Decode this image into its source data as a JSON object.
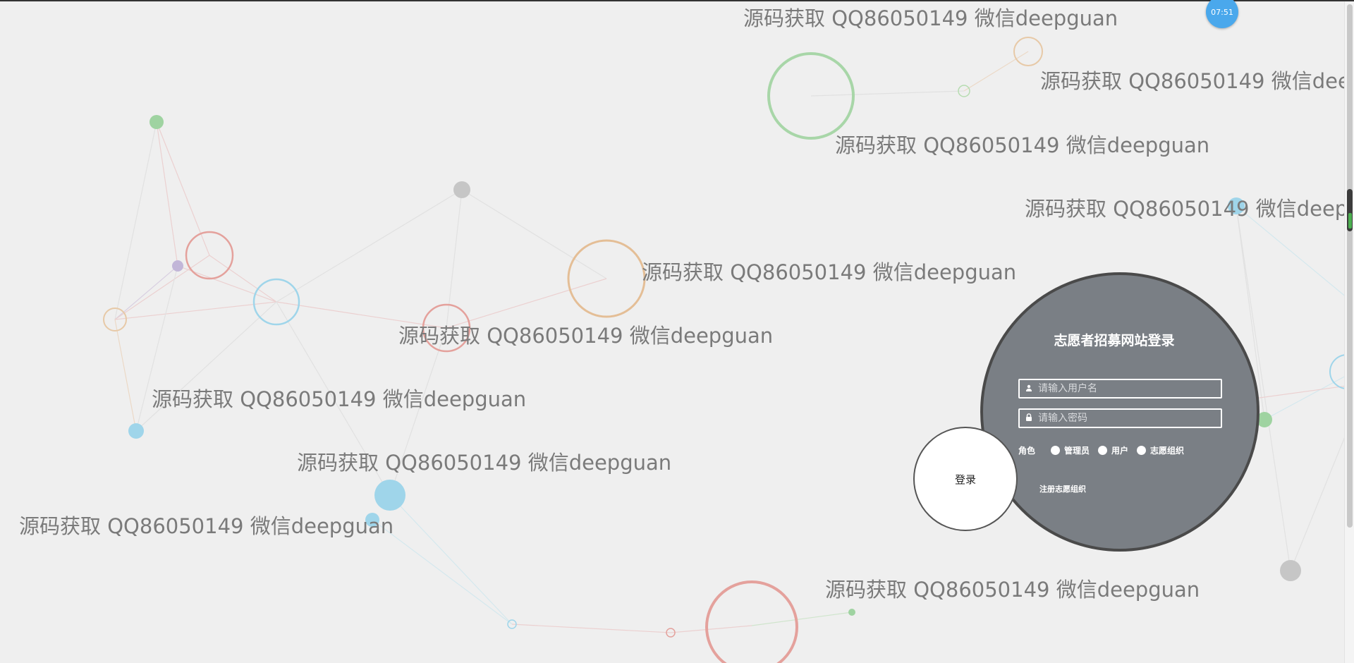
{
  "background": {
    "watermark_text": "源码获取 QQ86050149 微信deepguan"
  },
  "clock": {
    "time": "07:51"
  },
  "login": {
    "title": "志愿者招募网站登录",
    "username_placeholder": "请输入用户名",
    "password_placeholder": "请输入密码",
    "role_label": "角色",
    "roles": [
      "管理员",
      "用户",
      "志愿组织"
    ],
    "submit_label": "登录",
    "register_link": "注册志愿组织"
  },
  "colors": {
    "page_bg": "#efefef",
    "login_panel": "#7a7f85",
    "clock": "#4aa8ec"
  }
}
